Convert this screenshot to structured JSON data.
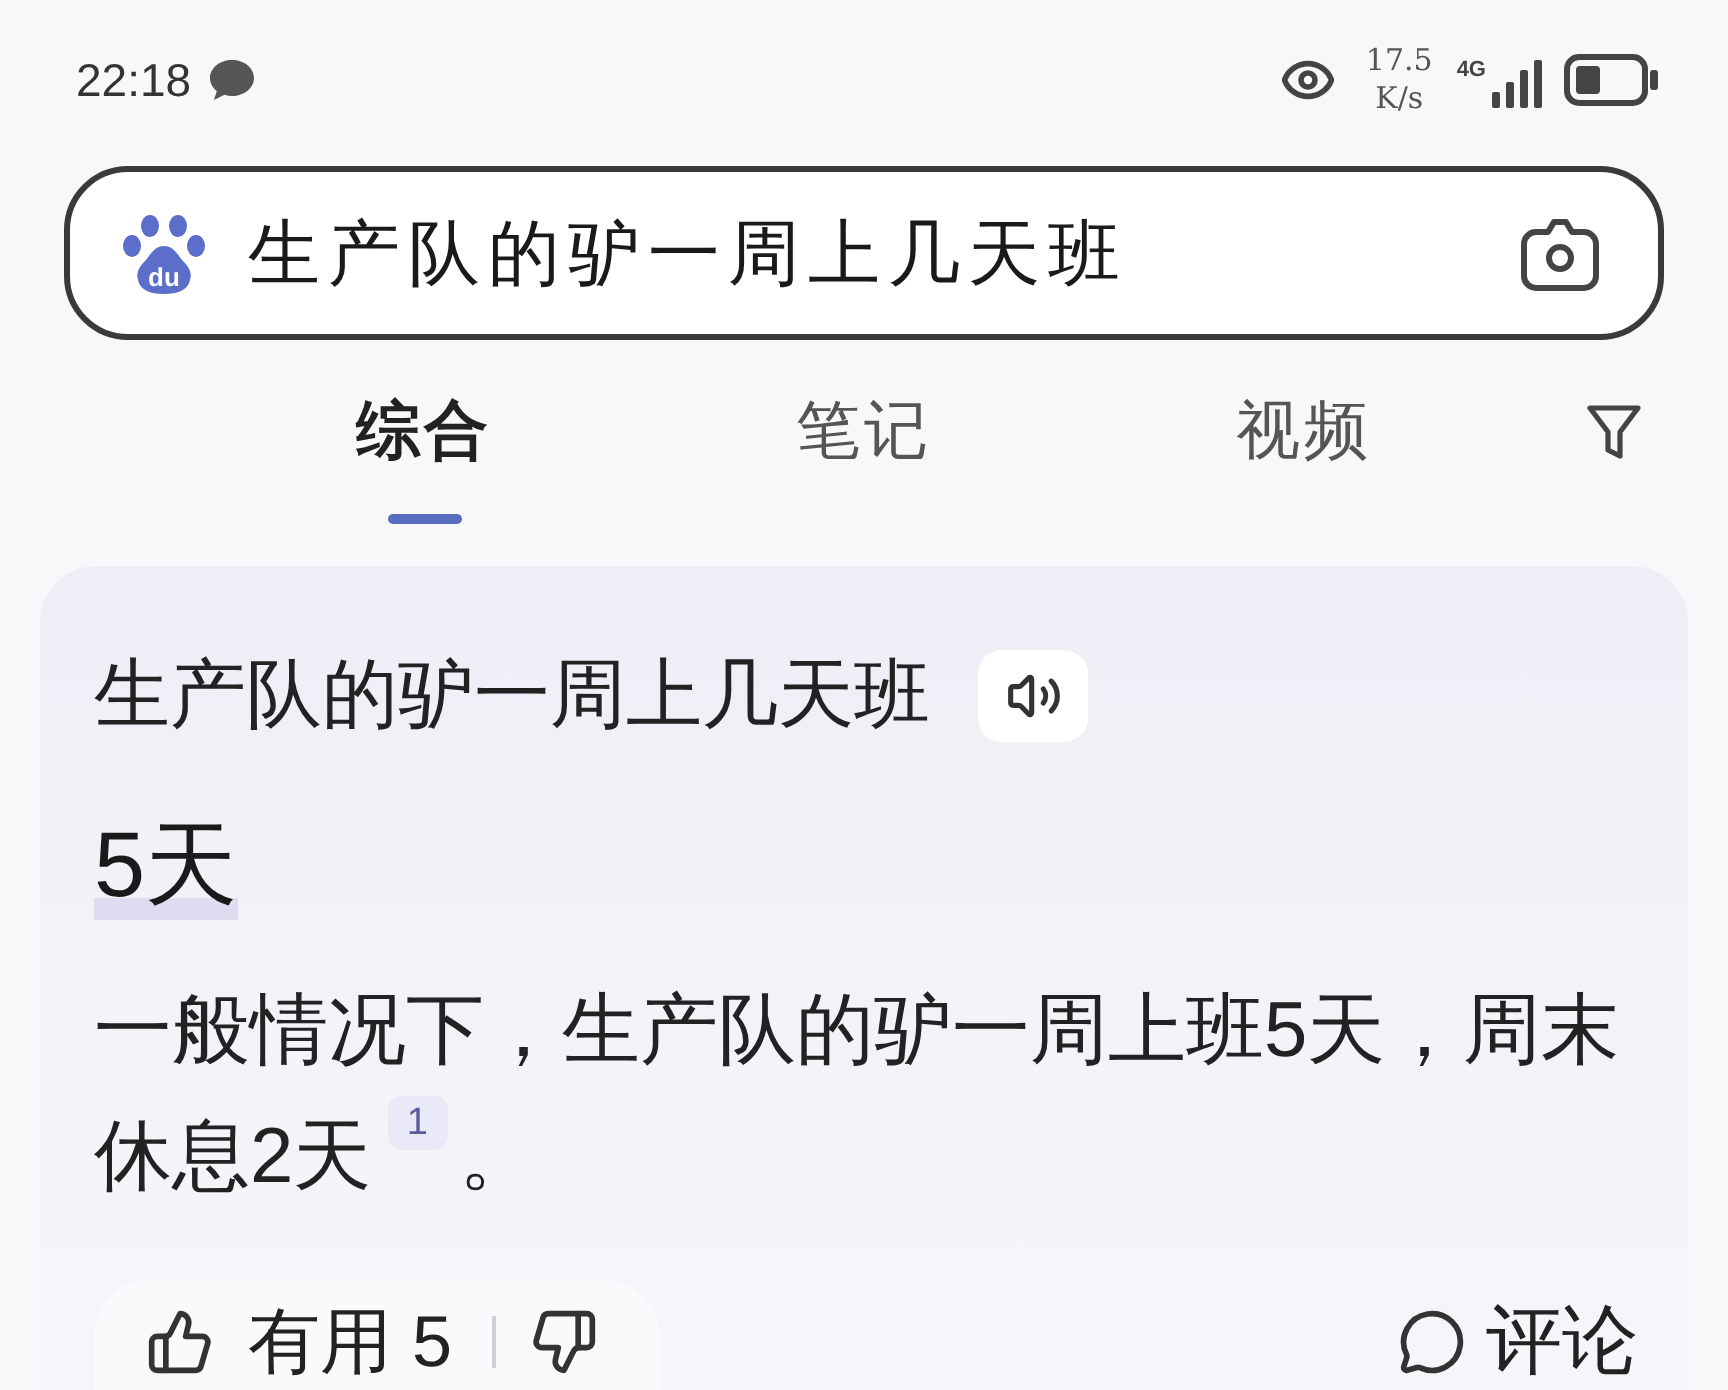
{
  "status_bar": {
    "time": "22:18",
    "speed_value": "17.5",
    "speed_unit": "K/s",
    "network": "4G"
  },
  "search": {
    "logo_text": "du",
    "value": "生产队的驴一周上几天班"
  },
  "tabs": [
    {
      "label": "综合",
      "selected": true
    },
    {
      "label": "笔记",
      "selected": false
    },
    {
      "label": "视频",
      "selected": false
    }
  ],
  "answer_card": {
    "question": "生产队的驴一周上几天班",
    "answer": "5天",
    "body": "一般情况下，生产队的驴一周上班5天，周末休息2天",
    "citation": "1",
    "body_end": "。",
    "useful_label": "有用 5",
    "comment_label": "评论"
  }
}
